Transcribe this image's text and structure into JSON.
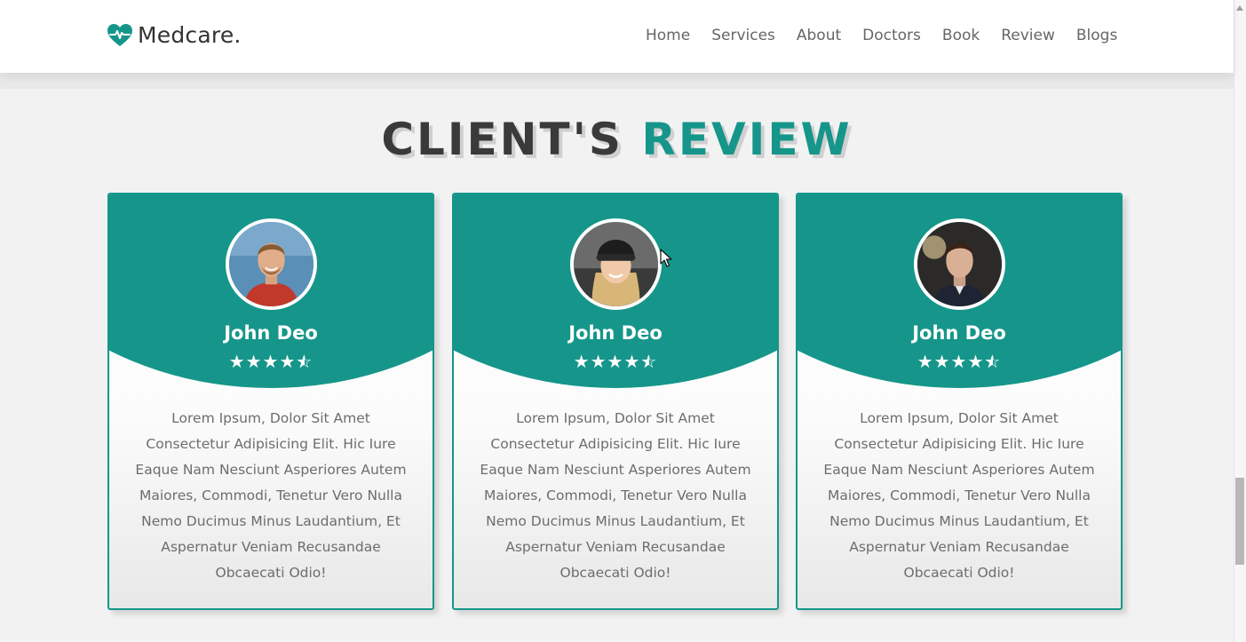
{
  "header": {
    "logo_icon": "heart-pulse-icon",
    "logo_text": "Medcare.",
    "nav": [
      "Home",
      "Services",
      "About",
      "Doctors",
      "Book",
      "Review",
      "Blogs"
    ]
  },
  "section": {
    "heading_main": "Client's",
    "heading_accent": "Review"
  },
  "reviews": [
    {
      "avatar": "man-smiling-avatar",
      "name": "John Deo",
      "rating": 4.5,
      "text": "Lorem Ipsum, Dolor Sit Amet Consectetur Adipisicing Elit. Hic Iure Eaque Nam Nesciunt Asperiores Autem Maiores, Commodi, Tenetur Vero Nulla Nemo Ducimus Minus Laudantium, Et Aspernatur Veniam Recusandae Obcaecati Odio!"
    },
    {
      "avatar": "woman-beanie-avatar",
      "name": "John Deo",
      "rating": 4.5,
      "text": "Lorem Ipsum, Dolor Sit Amet Consectetur Adipisicing Elit. Hic Iure Eaque Nam Nesciunt Asperiores Autem Maiores, Commodi, Tenetur Vero Nulla Nemo Ducimus Minus Laudantium, Et Aspernatur Veniam Recusandae Obcaecati Odio!"
    },
    {
      "avatar": "man-portrait-avatar",
      "name": "John Deo",
      "rating": 4.5,
      "text": "Lorem Ipsum, Dolor Sit Amet Consectetur Adipisicing Elit. Hic Iure Eaque Nam Nesciunt Asperiores Autem Maiores, Commodi, Tenetur Vero Nulla Nemo Ducimus Minus Laudantium, Et Aspernatur Veniam Recusandae Obcaecati Odio!"
    }
  ],
  "colors": {
    "accent": "#16968a",
    "heading": "#3a3a3a",
    "body_text": "#6d6d6d",
    "background": "#f2f2f2"
  }
}
